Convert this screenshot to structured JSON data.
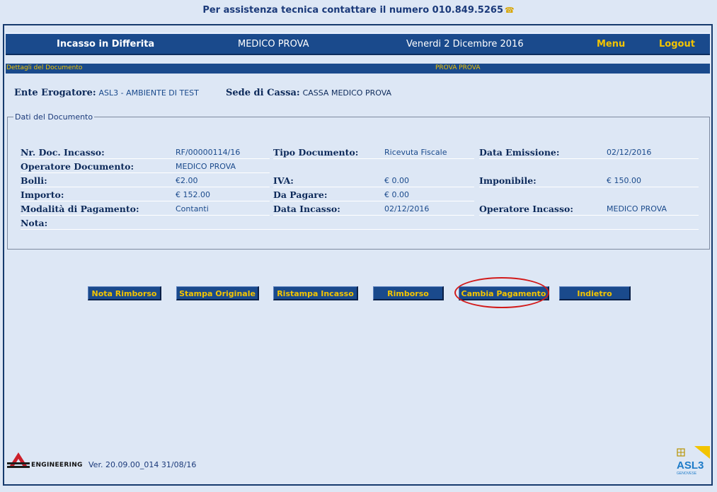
{
  "top_help": "Per assistenza tecnica contattare il numero 010.849.5265",
  "header": {
    "title": "Incasso in Differita",
    "user": "MEDICO PROVA",
    "date": "Venerdi 2 Dicembre 2016",
    "menu_label": "Menu",
    "logout_label": "Logout"
  },
  "sub_bar": {
    "section": "Dettagli del Documento",
    "user": "PROVA PROVA"
  },
  "ente": {
    "label": "Ente Erogatore:",
    "value": "ASL3 - AMBIENTE DI TEST"
  },
  "sede": {
    "label": "Sede di Cassa:",
    "value": "CASSA MEDICO PROVA"
  },
  "document": {
    "legend": "Dati del Documento",
    "fields": {
      "nr_doc": {
        "label": "Nr. Doc. Incasso:",
        "value": "RF/00000114/16"
      },
      "tipo_doc": {
        "label": "Tipo Documento:",
        "value": "Ricevuta Fiscale"
      },
      "data_emissione": {
        "label": "Data Emissione:",
        "value": "02/12/2016"
      },
      "operatore_doc": {
        "label": "Operatore Documento:",
        "value": "MEDICO PROVA"
      },
      "bolli": {
        "label": "Bolli:",
        "value": "€2.00"
      },
      "iva": {
        "label": "IVA:",
        "value": "€ 0.00"
      },
      "imponibile": {
        "label": "Imponibile:",
        "value": "€ 150.00"
      },
      "importo": {
        "label": "Importo:",
        "value": "€ 152.00"
      },
      "da_pagare": {
        "label": "Da Pagare:",
        "value": "€ 0.00"
      },
      "modalita": {
        "label": "Modalità di Pagamento:",
        "value": "Contanti"
      },
      "data_incasso": {
        "label": "Data Incasso:",
        "value": "02/12/2016"
      },
      "operatore_incasso": {
        "label": "Operatore Incasso:",
        "value": "MEDICO PROVA"
      },
      "nota": {
        "label": "Nota:",
        "value": ""
      }
    }
  },
  "buttons": {
    "nota_rimborso": "Nota Rimborso",
    "stampa_originale": "Stampa Originale",
    "ristampa_incasso": "Ristampa Incasso",
    "rimborso": "Rimborso",
    "cambia_pagamento": "Cambia Pagamento",
    "indietro": "Indietro"
  },
  "footer": {
    "company": "ENGINEERING",
    "version": "Ver. 20.09.00_014 31/08/16",
    "asl_logo_text": "ASL3",
    "asl_logo_subtext": "GENOVESE"
  },
  "colors": {
    "bar": "#1a4a8c",
    "accent": "#f3c400",
    "background": "#dde7f5",
    "highlight": "#d21a1a"
  }
}
